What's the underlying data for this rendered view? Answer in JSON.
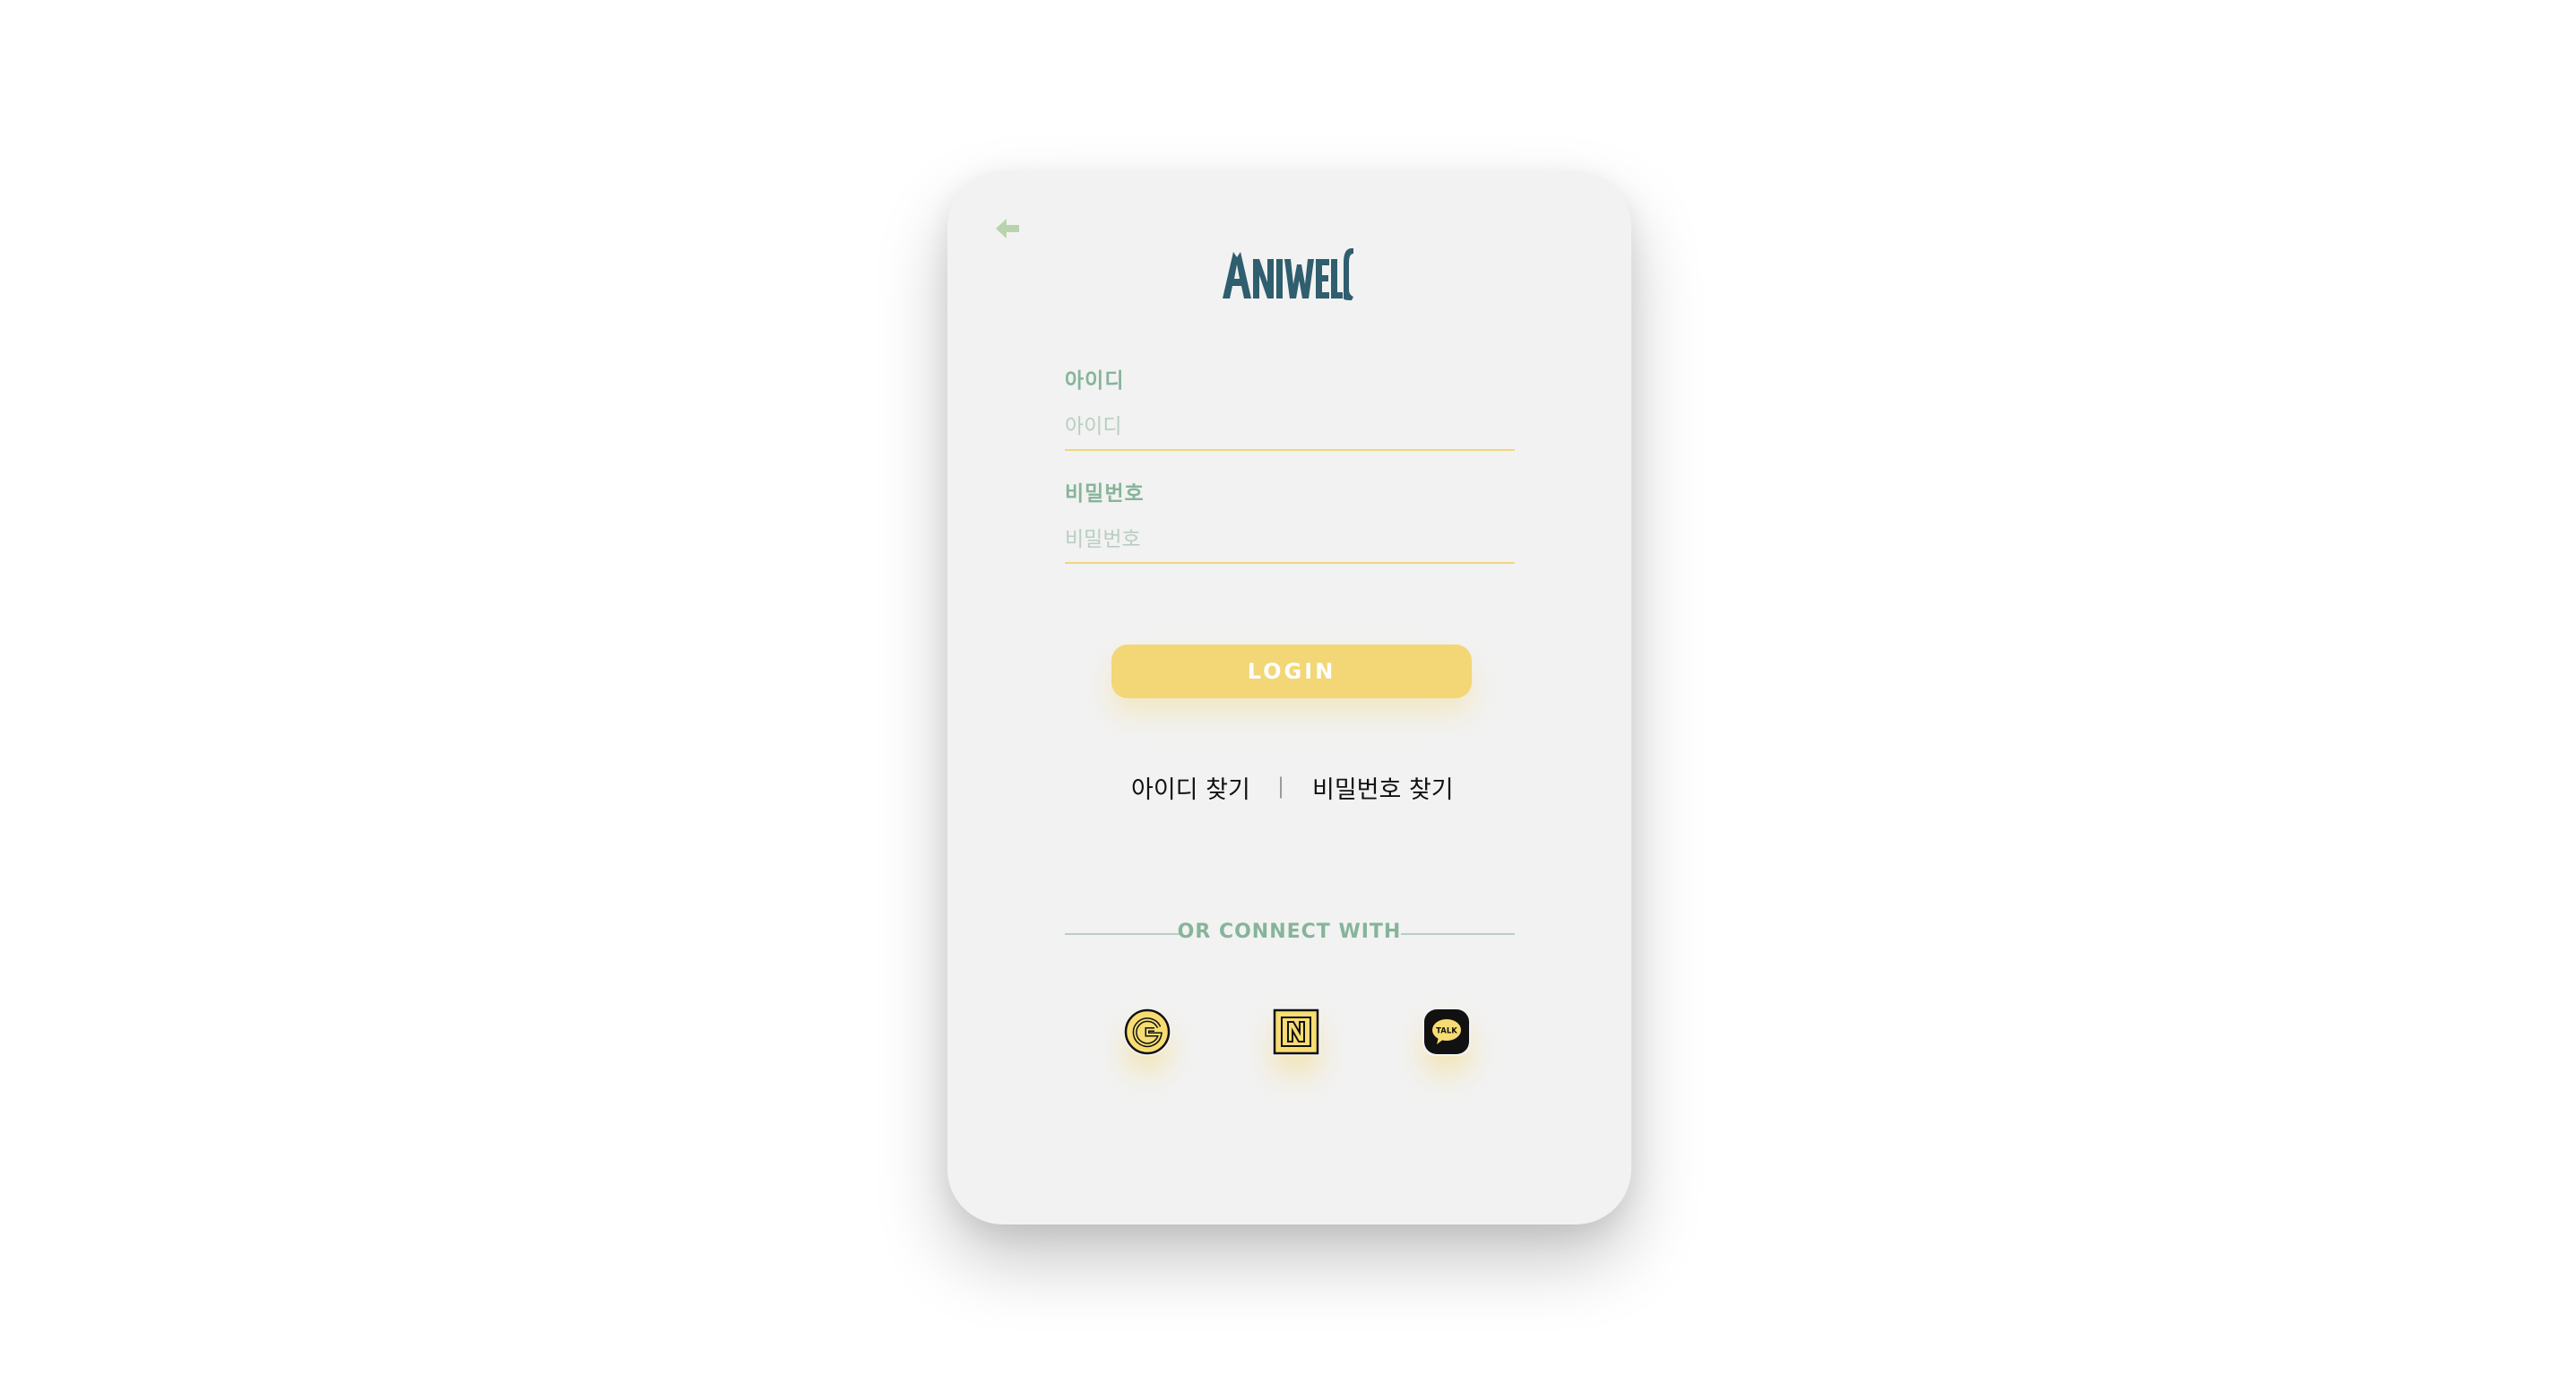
{
  "brand": {
    "name": "ANIWELL",
    "logo_color": "#2f5e6e"
  },
  "icons": {
    "back": "arrow-left-icon",
    "google": "google-icon",
    "naver": "naver-icon",
    "kakao": "kakao-talk-icon"
  },
  "form": {
    "id_label": "아이디",
    "id_placeholder": "아이디",
    "password_label": "비밀번호",
    "password_placeholder": "비밀번호",
    "login_label": "LOGIN"
  },
  "links": {
    "find_id": "아이디 찾기",
    "separator": "|",
    "find_password": "비밀번호 찾기"
  },
  "social": {
    "divider_text": "OR CONNECT WITH",
    "kakao_badge": "TALK"
  },
  "colors": {
    "accent_yellow": "#f3d676",
    "label_green": "#86b49a",
    "card_bg": "#f2f2f2"
  }
}
